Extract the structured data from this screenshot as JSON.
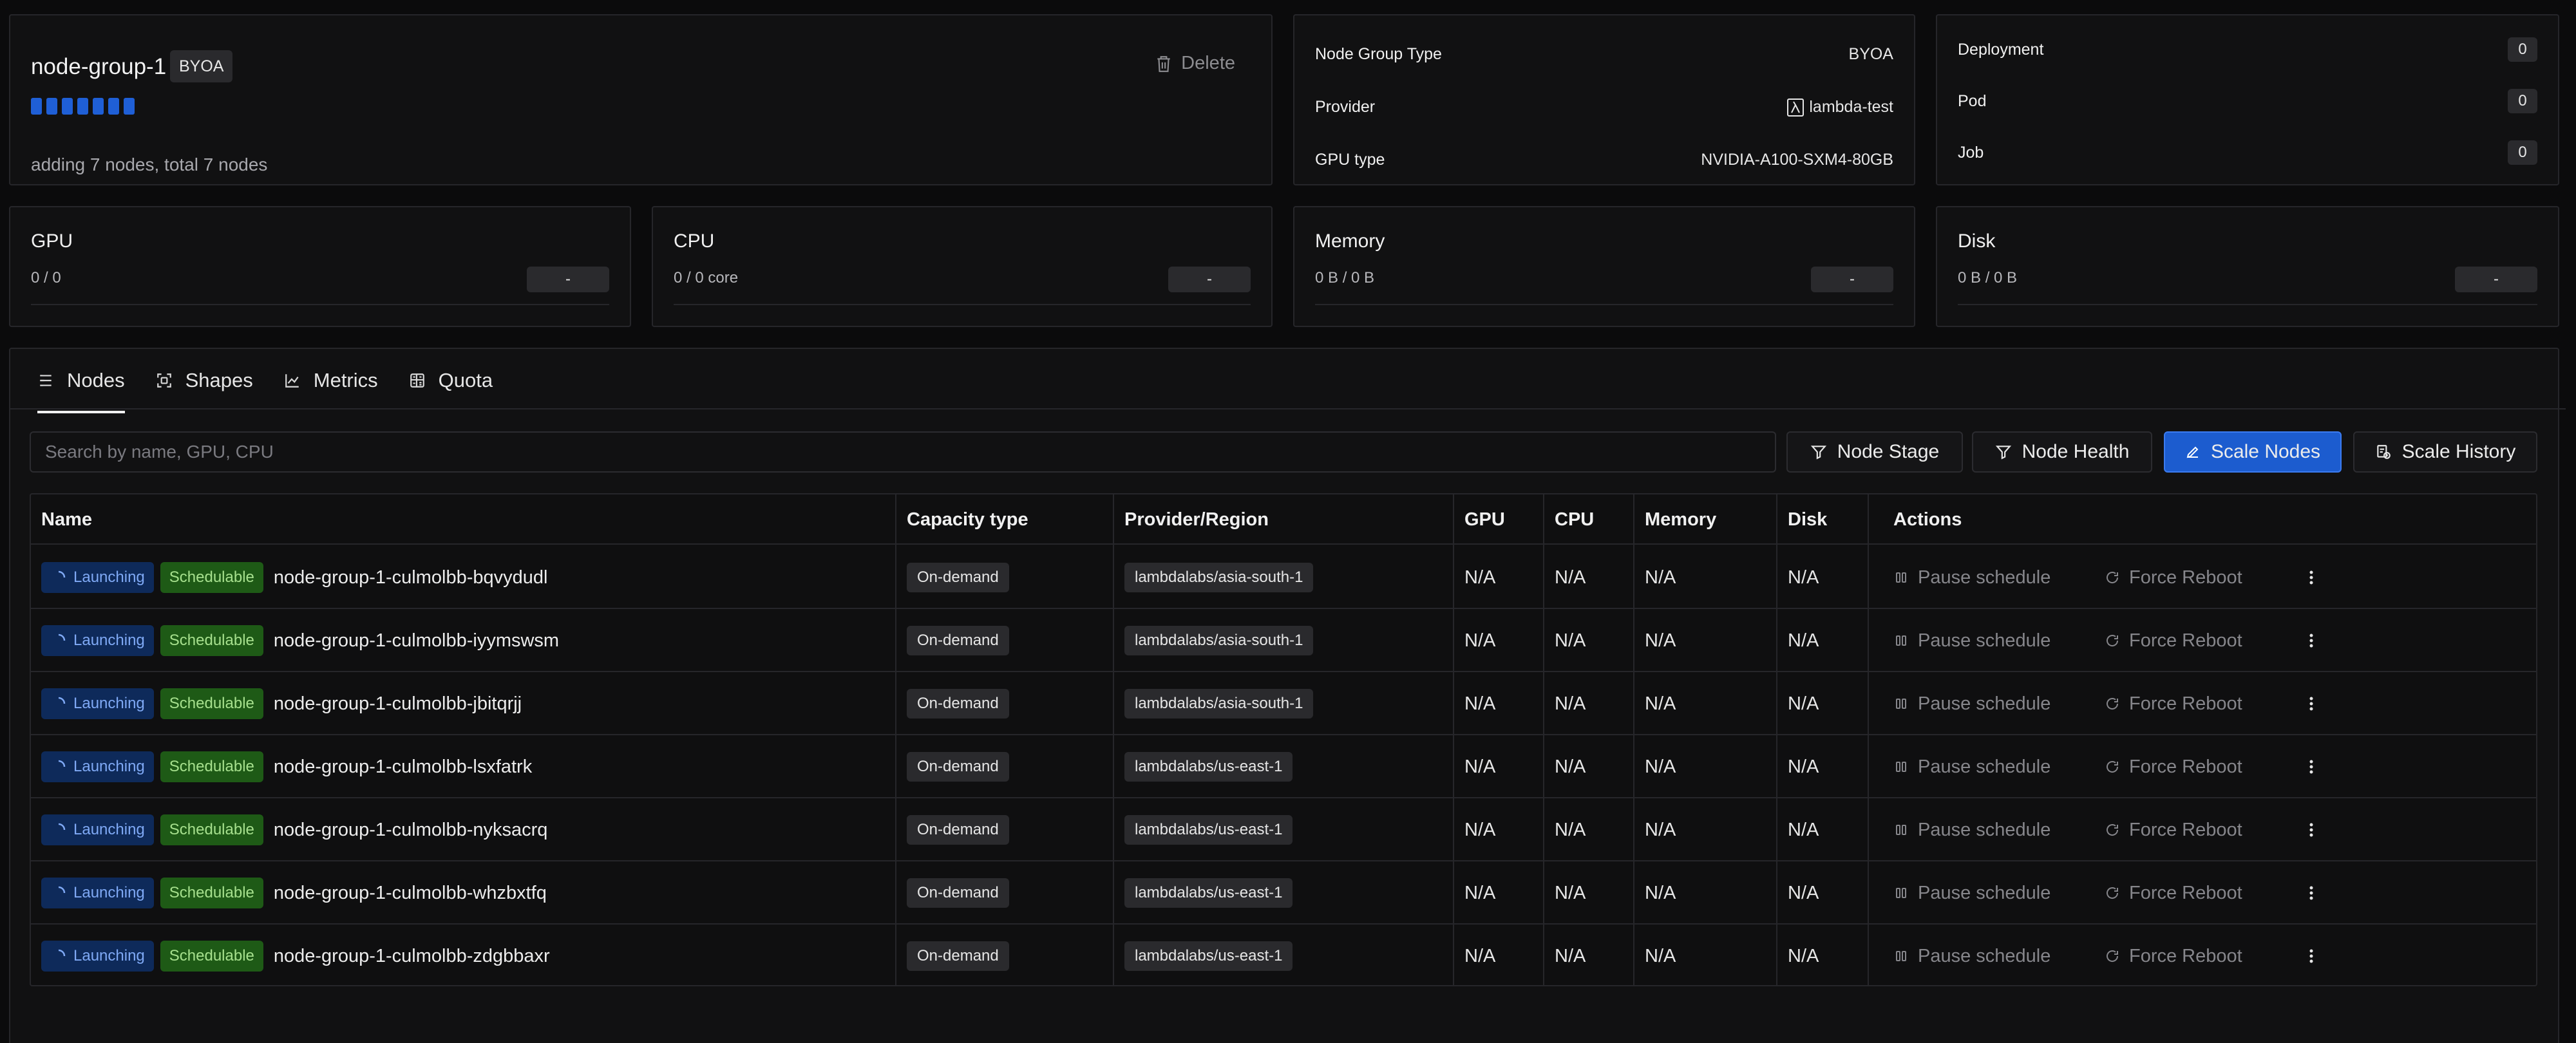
{
  "node_group": {
    "name": "node-group-1",
    "type_badge": "BYOA",
    "delete_label": "Delete",
    "status": "adding 7 nodes, total 7 nodes",
    "progress": {
      "ready": 0,
      "total": 7
    }
  },
  "info": {
    "rows": [
      {
        "label": "Node Group Type",
        "value": "BYOA"
      },
      {
        "label": "Provider",
        "value": "lambda-test"
      },
      {
        "label": "GPU type",
        "value": "NVIDIA-A100-SXM4-80GB"
      }
    ]
  },
  "workloads": [
    {
      "label": "Deployment",
      "count": "0"
    },
    {
      "label": "Pod",
      "count": "0"
    },
    {
      "label": "Job",
      "count": "0"
    }
  ],
  "resources": [
    {
      "title": "GPU",
      "value": "0 / 0",
      "bar": "-"
    },
    {
      "title": "CPU",
      "value": "0 / 0 core",
      "bar": "-"
    },
    {
      "title": "Memory",
      "value": "0 B / 0 B",
      "bar": "-"
    },
    {
      "title": "Disk",
      "value": "0 B / 0 B",
      "bar": "-"
    }
  ],
  "tabs": [
    {
      "label": "Nodes",
      "icon": "list-icon",
      "active": true
    },
    {
      "label": "Shapes",
      "icon": "shapes-icon",
      "active": false
    },
    {
      "label": "Metrics",
      "icon": "chart-icon",
      "active": false
    },
    {
      "label": "Quota",
      "icon": "calculator-icon",
      "active": false
    }
  ],
  "search": {
    "placeholder": "Search by name, GPU, CPU"
  },
  "toolbar": {
    "node_stage": "Node Stage",
    "node_health": "Node Health",
    "scale_nodes": "Scale Nodes",
    "scale_history": "Scale History"
  },
  "table": {
    "headers": [
      "Name",
      "Capacity type",
      "Provider/Region",
      "GPU",
      "CPU",
      "Memory",
      "Disk",
      "Actions"
    ],
    "status_label": "Launching",
    "sched_label": "Schedulable",
    "pause_label": "Pause schedule",
    "reboot_label": "Force Reboot",
    "rows": [
      {
        "name": "node-group-1-culmolbb-bqvydudl",
        "capacity": "On-demand",
        "region": "lambdalabs/asia-south-1",
        "gpu": "N/A",
        "cpu": "N/A",
        "memory": "N/A",
        "disk": "N/A"
      },
      {
        "name": "node-group-1-culmolbb-iyymswsm",
        "capacity": "On-demand",
        "region": "lambdalabs/asia-south-1",
        "gpu": "N/A",
        "cpu": "N/A",
        "memory": "N/A",
        "disk": "N/A"
      },
      {
        "name": "node-group-1-culmolbb-jbitqrjj",
        "capacity": "On-demand",
        "region": "lambdalabs/asia-south-1",
        "gpu": "N/A",
        "cpu": "N/A",
        "memory": "N/A",
        "disk": "N/A"
      },
      {
        "name": "node-group-1-culmolbb-lsxfatrk",
        "capacity": "On-demand",
        "region": "lambdalabs/us-east-1",
        "gpu": "N/A",
        "cpu": "N/A",
        "memory": "N/A",
        "disk": "N/A"
      },
      {
        "name": "node-group-1-culmolbb-nyksacrq",
        "capacity": "On-demand",
        "region": "lambdalabs/us-east-1",
        "gpu": "N/A",
        "cpu": "N/A",
        "memory": "N/A",
        "disk": "N/A"
      },
      {
        "name": "node-group-1-culmolbb-whzbxtfq",
        "capacity": "On-demand",
        "region": "lambdalabs/us-east-1",
        "gpu": "N/A",
        "cpu": "N/A",
        "memory": "N/A",
        "disk": "N/A"
      },
      {
        "name": "node-group-1-culmolbb-zdgbbaxr",
        "capacity": "On-demand",
        "region": "lambdalabs/us-east-1",
        "gpu": "N/A",
        "cpu": "N/A",
        "memory": "N/A",
        "disk": "N/A"
      }
    ]
  },
  "colors": {
    "accent": "#1c5ccf",
    "launching_bg": "#0e2a5a",
    "schedulable_bg": "#1e5a16",
    "progress_segment": "#1f5fd6"
  }
}
